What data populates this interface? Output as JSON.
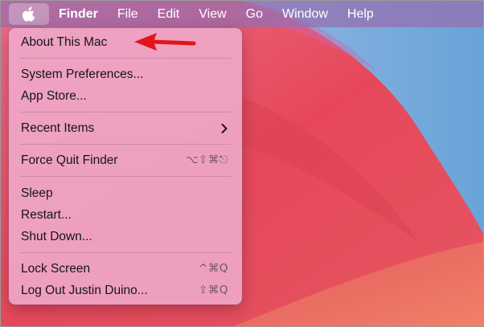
{
  "menubar": {
    "apple_icon": "apple-logo-icon",
    "items": [
      "Finder",
      "File",
      "Edit",
      "View",
      "Go",
      "Window",
      "Help"
    ]
  },
  "apple_menu": {
    "about": "About This Mac",
    "system_preferences": "System Preferences...",
    "app_store": "App Store...",
    "recent_items": "Recent Items",
    "force_quit": {
      "label": "Force Quit Finder",
      "shortcut": "⌥⇧⌘⎋"
    },
    "sleep": "Sleep",
    "restart": "Restart...",
    "shut_down": "Shut Down...",
    "lock_screen": {
      "label": "Lock Screen",
      "shortcut": "^⌘Q"
    },
    "log_out": {
      "label": "Log Out Justin Duino...",
      "shortcut": "⇧⌘Q"
    }
  },
  "annotation": {
    "arrow_color": "#e0161c",
    "points_to": "About This Mac"
  },
  "colors": {
    "menubar": "#9a6fb0",
    "menu_background": "#eea8ca",
    "wallpaper_pink": "#e64b55",
    "wallpaper_blue": "#6fa8dc"
  }
}
